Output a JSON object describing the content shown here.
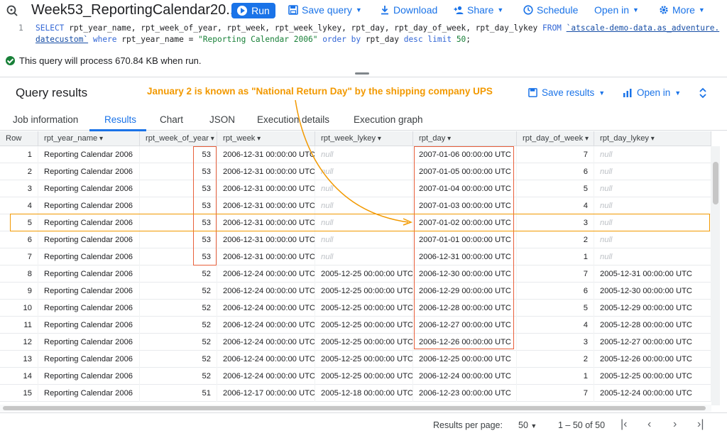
{
  "toolbar": {
    "query_icon": "query-magnifier-icon",
    "title": "Week53_ReportingCalendar20...",
    "run_label": "Run",
    "save_query_label": "Save query",
    "download_label": "Download",
    "share_label": "Share",
    "schedule_label": "Schedule",
    "open_in_label": "Open in",
    "more_label": "More"
  },
  "editor": {
    "line_number": "1",
    "line1_kw1": "SELECT",
    "line1_cols": " rpt_year_name, rpt_week_of_year, rpt_week, rpt_week_lykey, rpt_day, rpt_day_of_week, rpt_day_lykey ",
    "line1_kw2": "FROM",
    "line1_tbl": "`atscale-demo-data.as_adventure.",
    "line2_tbl": "datecustom`",
    "line2_kw1": "where",
    "line2_mid": " rpt_year_name = ",
    "line2_str": "\"Reporting Calendar 2006\"",
    "line2_kw2": "order by",
    "line2_mid2": " rpt_day ",
    "line2_kw3": "desc limit",
    "line2_num": "50",
    "line2_end": ";"
  },
  "status": {
    "process_text": "This query will process 670.84 KB when run."
  },
  "results": {
    "title": "Query results",
    "annotation": "January 2 is known as \"National Return Day\" by the shipping company UPS",
    "save_results_label": "Save results",
    "open_in_label": "Open in"
  },
  "tabs": [
    "Job information",
    "Results",
    "Chart",
    "JSON",
    "Execution details",
    "Execution graph"
  ],
  "table": {
    "headers": [
      "Row",
      "rpt_year_name",
      "rpt_week_of_year",
      "rpt_week",
      "rpt_week_lykey",
      "rpt_day",
      "rpt_day_of_week",
      "rpt_day_lykey"
    ],
    "rows": [
      [
        "1",
        "Reporting Calendar 2006",
        "53",
        "2006-12-31 00:00:00 UTC",
        "null",
        "2007-01-06 00:00:00 UTC",
        "7",
        "null"
      ],
      [
        "2",
        "Reporting Calendar 2006",
        "53",
        "2006-12-31 00:00:00 UTC",
        "null",
        "2007-01-05 00:00:00 UTC",
        "6",
        "null"
      ],
      [
        "3",
        "Reporting Calendar 2006",
        "53",
        "2006-12-31 00:00:00 UTC",
        "null",
        "2007-01-04 00:00:00 UTC",
        "5",
        "null"
      ],
      [
        "4",
        "Reporting Calendar 2006",
        "53",
        "2006-12-31 00:00:00 UTC",
        "null",
        "2007-01-03 00:00:00 UTC",
        "4",
        "null"
      ],
      [
        "5",
        "Reporting Calendar 2006",
        "53",
        "2006-12-31 00:00:00 UTC",
        "null",
        "2007-01-02 00:00:00 UTC",
        "3",
        "null"
      ],
      [
        "6",
        "Reporting Calendar 2006",
        "53",
        "2006-12-31 00:00:00 UTC",
        "null",
        "2007-01-01 00:00:00 UTC",
        "2",
        "null"
      ],
      [
        "7",
        "Reporting Calendar 2006",
        "53",
        "2006-12-31 00:00:00 UTC",
        "null",
        "2006-12-31 00:00:00 UTC",
        "1",
        "null"
      ],
      [
        "8",
        "Reporting Calendar 2006",
        "52",
        "2006-12-24 00:00:00 UTC",
        "2005-12-25 00:00:00 UTC",
        "2006-12-30 00:00:00 UTC",
        "7",
        "2005-12-31 00:00:00 UTC"
      ],
      [
        "9",
        "Reporting Calendar 2006",
        "52",
        "2006-12-24 00:00:00 UTC",
        "2005-12-25 00:00:00 UTC",
        "2006-12-29 00:00:00 UTC",
        "6",
        "2005-12-30 00:00:00 UTC"
      ],
      [
        "10",
        "Reporting Calendar 2006",
        "52",
        "2006-12-24 00:00:00 UTC",
        "2005-12-25 00:00:00 UTC",
        "2006-12-28 00:00:00 UTC",
        "5",
        "2005-12-29 00:00:00 UTC"
      ],
      [
        "11",
        "Reporting Calendar 2006",
        "52",
        "2006-12-24 00:00:00 UTC",
        "2005-12-25 00:00:00 UTC",
        "2006-12-27 00:00:00 UTC",
        "4",
        "2005-12-28 00:00:00 UTC"
      ],
      [
        "12",
        "Reporting Calendar 2006",
        "52",
        "2006-12-24 00:00:00 UTC",
        "2005-12-25 00:00:00 UTC",
        "2006-12-26 00:00:00 UTC",
        "3",
        "2005-12-27 00:00:00 UTC"
      ],
      [
        "13",
        "Reporting Calendar 2006",
        "52",
        "2006-12-24 00:00:00 UTC",
        "2005-12-25 00:00:00 UTC",
        "2006-12-25 00:00:00 UTC",
        "2",
        "2005-12-26 00:00:00 UTC"
      ],
      [
        "14",
        "Reporting Calendar 2006",
        "52",
        "2006-12-24 00:00:00 UTC",
        "2005-12-25 00:00:00 UTC",
        "2006-12-24 00:00:00 UTC",
        "1",
        "2005-12-25 00:00:00 UTC"
      ],
      [
        "15",
        "Reporting Calendar 2006",
        "51",
        "2006-12-17 00:00:00 UTC",
        "2005-12-18 00:00:00 UTC",
        "2006-12-23 00:00:00 UTC",
        "7",
        "2005-12-24 00:00:00 UTC"
      ]
    ]
  },
  "pager": {
    "label": "Results per page:",
    "size": "50",
    "range": "1 – 50 of 50",
    "first_icon": "first-page-icon",
    "prev_icon": "prev-page-icon",
    "next_icon": "next-page-icon",
    "last_icon": "last-page-icon"
  },
  "colors": {
    "accent": "#1a73e8",
    "annotation": "#f29900",
    "highlight_box": "#e8603c"
  }
}
